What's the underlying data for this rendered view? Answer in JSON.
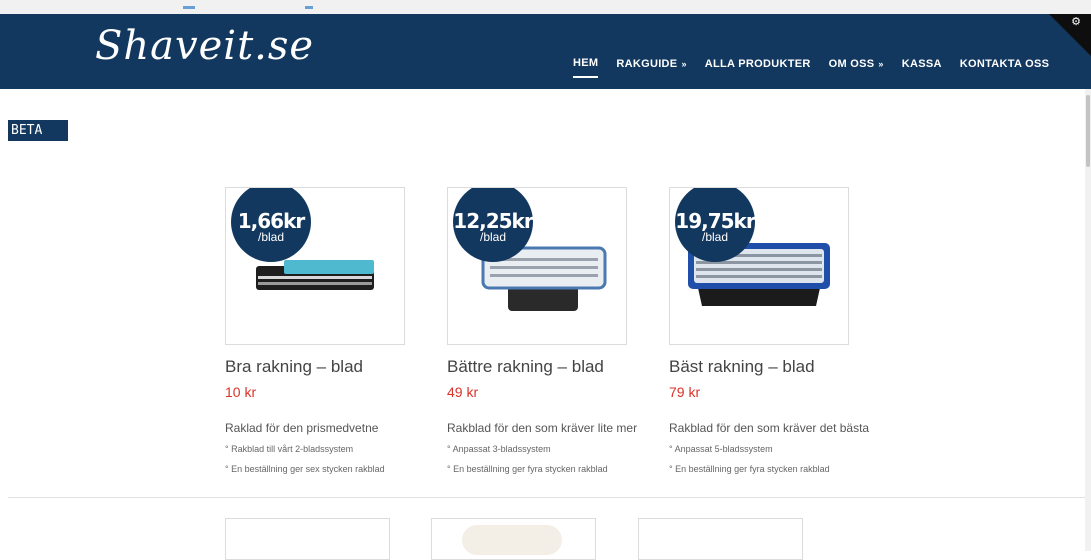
{
  "site": {
    "logo_text": "Shaveit.se"
  },
  "nav": {
    "items": [
      {
        "label": "HEM",
        "active": true,
        "has_dropdown": false
      },
      {
        "label": "RAKGUIDE",
        "active": false,
        "has_dropdown": true
      },
      {
        "label": "ALLA PRODUKTER",
        "active": false,
        "has_dropdown": false
      },
      {
        "label": "OM OSS",
        "active": false,
        "has_dropdown": true
      },
      {
        "label": "KASSA",
        "active": false,
        "has_dropdown": false
      },
      {
        "label": "KONTAKTA OSS",
        "active": false,
        "has_dropdown": false
      }
    ],
    "dropdown_glyph": "»"
  },
  "corner_icon": "gear-icon",
  "beta_label": "BETA",
  "products": [
    {
      "badge_price": "1,66kr",
      "badge_unit": "/blad",
      "name": "Bra rakning – blad",
      "price": "10 kr",
      "description": "Raklad för den prismedvetne",
      "features": [
        "° Rakblad till vårt 2-bladssystem",
        "° En beställning ger sex stycken rakblad"
      ]
    },
    {
      "badge_price": "12,25kr",
      "badge_unit": "/blad",
      "name": "Bättre rakning – blad",
      "price": "49 kr",
      "description": "Rakblad för den som kräver lite mer",
      "features": [
        "° Anpassat 3-bladssystem",
        "° En beställning ger fyra stycken rakblad"
      ]
    },
    {
      "badge_price": "19,75kr",
      "badge_unit": "/blad",
      "name": "Bäst rakning – blad",
      "price": "79 kr",
      "description": "Rakblad för den som kräver det bästa",
      "features": [
        "° Anpassat 5-bladssystem",
        "° En beställning ger fyra stycken rakblad"
      ]
    }
  ],
  "colors": {
    "header_bg": "#13385f",
    "price_red": "#d9332b",
    "badge_bg": "#13385f"
  }
}
